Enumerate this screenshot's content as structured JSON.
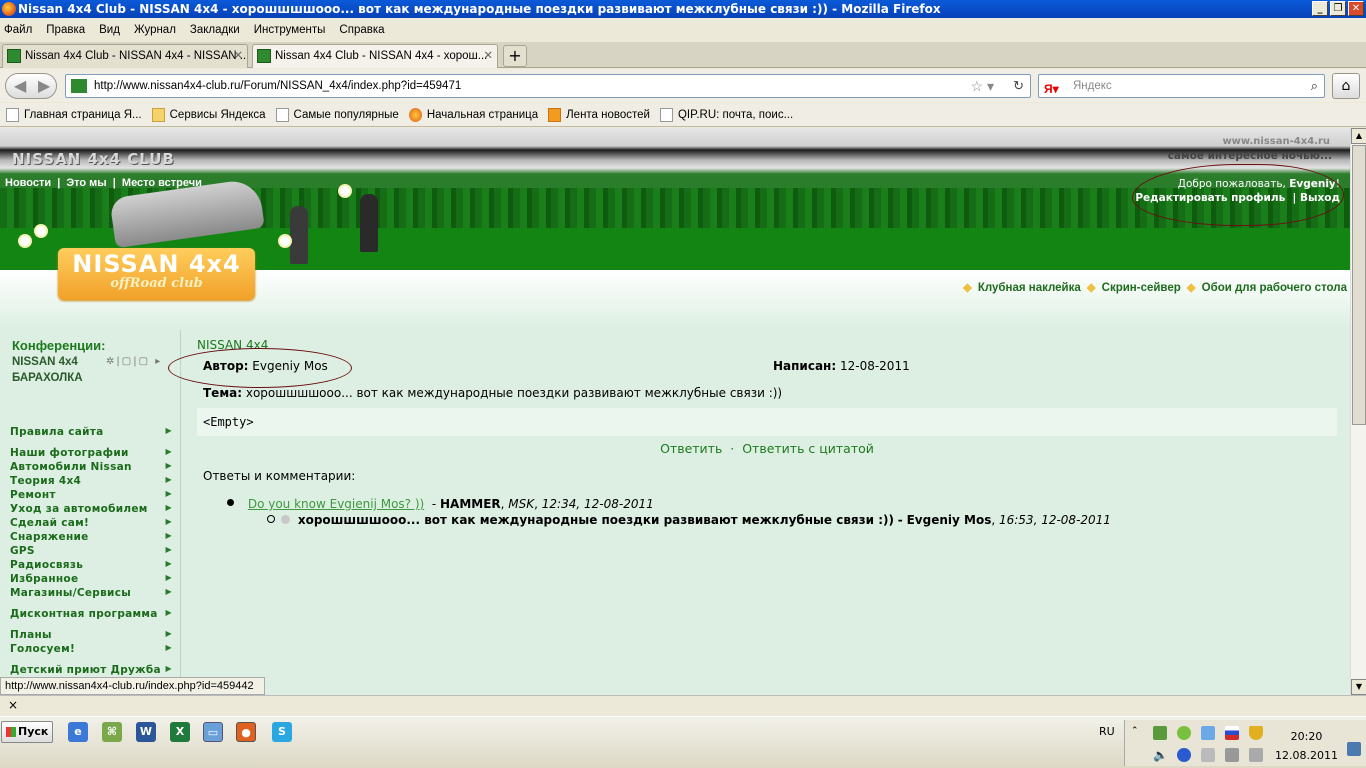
{
  "window": {
    "title": "Nissan 4x4 Club - NISSAN 4x4 - хорошшшшооо... вот как международные поездки развивают межклубные связи :)) - Mozilla Firefox",
    "controls": [
      "_",
      "❐",
      "✕"
    ]
  },
  "menu": [
    "Файл",
    "Правка",
    "Вид",
    "Журнал",
    "Закладки",
    "Инструменты",
    "Справка"
  ],
  "tabs": [
    {
      "label": "Nissan 4x4 Club - NISSAN 4x4 - NISSAN ..."
    },
    {
      "label": "Nissan 4x4 Club - NISSAN 4x4 - хорош..."
    }
  ],
  "nav": {
    "url": "http://www.nissan4x4-club.ru/Forum/NISSAN_4x4/index.php?id=459471",
    "search_placeholder": "Яндекс"
  },
  "bookmarks": [
    {
      "label": "Главная страница Я...",
      "icon": "page"
    },
    {
      "label": "Сервисы Яндекса",
      "icon": "folder"
    },
    {
      "label": "Самые популярные",
      "icon": "page"
    },
    {
      "label": "Начальная страница",
      "icon": "firefox"
    },
    {
      "label": "Лента новостей",
      "icon": "rss"
    },
    {
      "label": "QIP.RU: почта, поис...",
      "icon": "page"
    }
  ],
  "site": {
    "name": "NISSAN 4x4 CLUB",
    "url": "www.nissan-4x4.ru",
    "slogan": "самое интересное ночью...",
    "topnav": [
      "Новости",
      "|",
      "Это мы",
      "|",
      "Место встречи"
    ],
    "welcome_prefix": "Добро пожаловать,",
    "welcome_user": "Evgeniy",
    "welcome_suffix": "!",
    "edit_profile": "Редактировать профиль",
    "logout_sep": "|",
    "logout": "Выход",
    "logo_big": "NISSAN 4x4",
    "logo_small": "offRoad club",
    "quicklinks": [
      "Клубная наклейка",
      "Скрин-сейвер",
      "Обои для рабочего стола"
    ]
  },
  "sidebar": {
    "conf_title": "Конференции:",
    "conf_items": [
      "NISSAN 4x4",
      "БАРАХОЛКА"
    ],
    "conf_icons": "✲|▢|▢ ▸",
    "menu": [
      "Правила сайта",
      "Наши фотографии",
      "Автомобили Nissan",
      "Теория 4х4",
      "Ремонт",
      "Уход за автомобилем",
      "Сделай сам!",
      "Снаряжение",
      "GPS",
      "Радиосвязь",
      "Избранное",
      "Магазины/Сервисы",
      "Дисконтная программа",
      "Планы",
      "Голосуем!",
      "Детский приют Дружба"
    ]
  },
  "post": {
    "crumb": "NISSAN 4x4",
    "author_label": "Автор:",
    "author": "Evgeniy Mos",
    "written_label": "Написан:",
    "written": "12-08-2011",
    "subject_label": "Тема:",
    "subject": "хорошшшшооо... вот как международные поездки развивают межклубные связи :))",
    "body": "<Empty>",
    "reply": "Ответить",
    "sep": "·",
    "reply_quote": "Ответить с цитатой",
    "comments_title": "Ответы и комментарии:",
    "comments": [
      {
        "title": "Do you know Evgienij Mos? ))",
        "author": "HAMMER",
        "city": "MSK",
        "time": "12:34, 12-08-2011"
      },
      {
        "title": "хорошшшшооо... вот как международные поездки развивают межклубные связи :))",
        "author": "Evgeniy Mos",
        "time": "16:53, 12-08-2011"
      }
    ]
  },
  "statusbar": "http://www.nissan4x4-club.ru/index.php?id=459442",
  "findbar_close": "×",
  "taskbar": {
    "start": "Пуск",
    "lang": "RU",
    "time": "20:20",
    "date": "12.08.2011"
  }
}
